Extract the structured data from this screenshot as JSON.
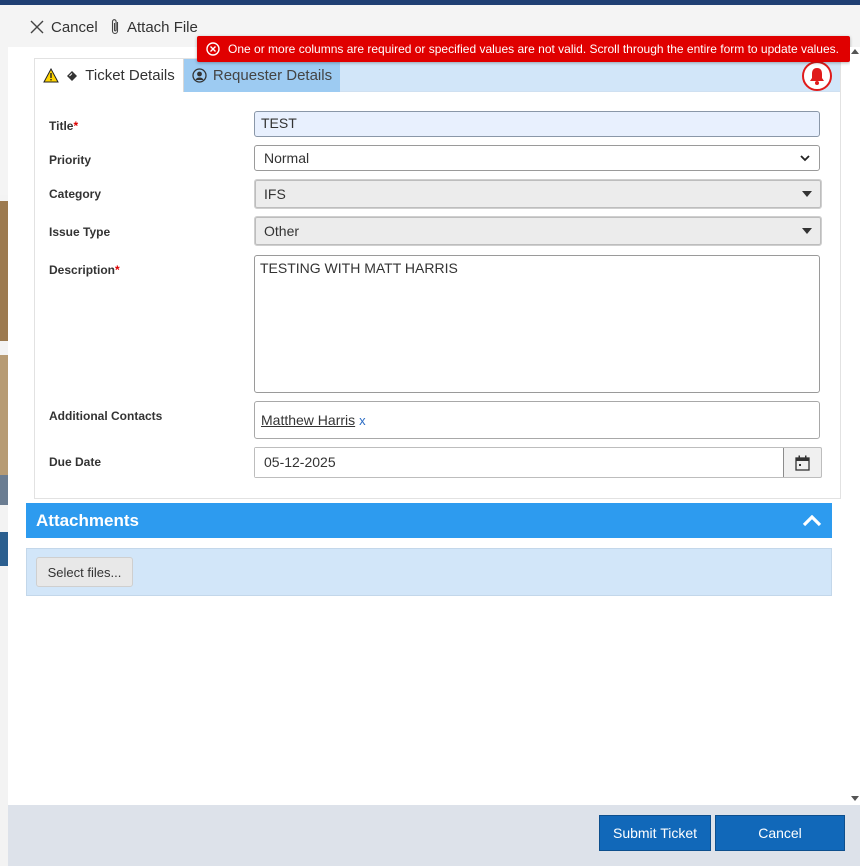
{
  "toolbar": {
    "cancel_label": "Cancel",
    "attach_label": "Attach File"
  },
  "error": {
    "message": "One or more columns are required or specified values are not valid. Scroll through the entire form to update values.",
    "color": "#e00000"
  },
  "tabs": [
    {
      "label": "Ticket Details",
      "active": true,
      "icons": [
        "warning-icon",
        "ticket-icon"
      ]
    },
    {
      "label": "Requester Details",
      "active": false,
      "icons": [
        "user-circle-icon"
      ]
    }
  ],
  "form": {
    "title": {
      "label": "Title",
      "required_mark": "*",
      "value": "TEST"
    },
    "priority": {
      "label": "Priority",
      "value": "Normal"
    },
    "category": {
      "label": "Category",
      "value": "IFS"
    },
    "issue_type": {
      "label": "Issue Type",
      "value": "Other"
    },
    "description": {
      "label": "Description",
      "required_mark": "*",
      "value": "TESTING WITH MATT HARRIS"
    },
    "additional_contacts": {
      "label": "Additional Contacts",
      "contacts": [
        {
          "name": "Matthew Harris",
          "remove": "x"
        }
      ]
    },
    "due_date": {
      "label": "Due Date",
      "value": "05-12-2025"
    }
  },
  "attachments": {
    "header": "Attachments",
    "select_files_label": "Select files..."
  },
  "footer": {
    "submit_label": "Submit Ticket",
    "cancel_label": "Cancel"
  },
  "colors": {
    "accent": "#2d9bef",
    "tab_bar": "#d2e6f9",
    "primary_button": "#1168b9",
    "alert_red": "#e01b1b"
  }
}
